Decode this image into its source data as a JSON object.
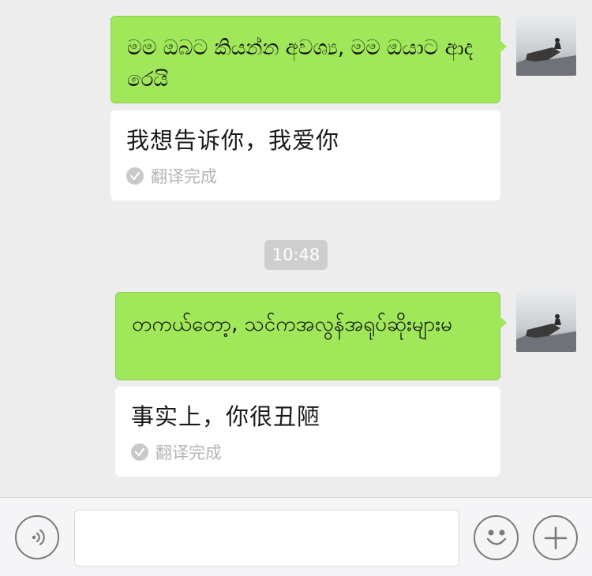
{
  "messages": [
    {
      "original": "මම ඔබට කියන්න අවශ්‍ය, මම ඔයාට ආදරෙයි",
      "translation": "我想告诉你，我爱你",
      "status": "翻译完成"
    },
    {
      "original": "တကယ်တော့, သင်ကအလွန်အရုပ်ဆိုးများမ",
      "translation": "事实上，你很丑陋",
      "status": "翻译完成"
    }
  ],
  "timestamp": "10:48",
  "input_bar": {
    "voice_icon": "voice-icon",
    "emoji_icon": "emoji-icon",
    "plus_icon": "plus-icon",
    "message_value": ""
  },
  "colors": {
    "sent_bubble": "#a0e75a",
    "background": "#ededed",
    "card": "#ffffff",
    "status_text": "#b5b5b5"
  }
}
